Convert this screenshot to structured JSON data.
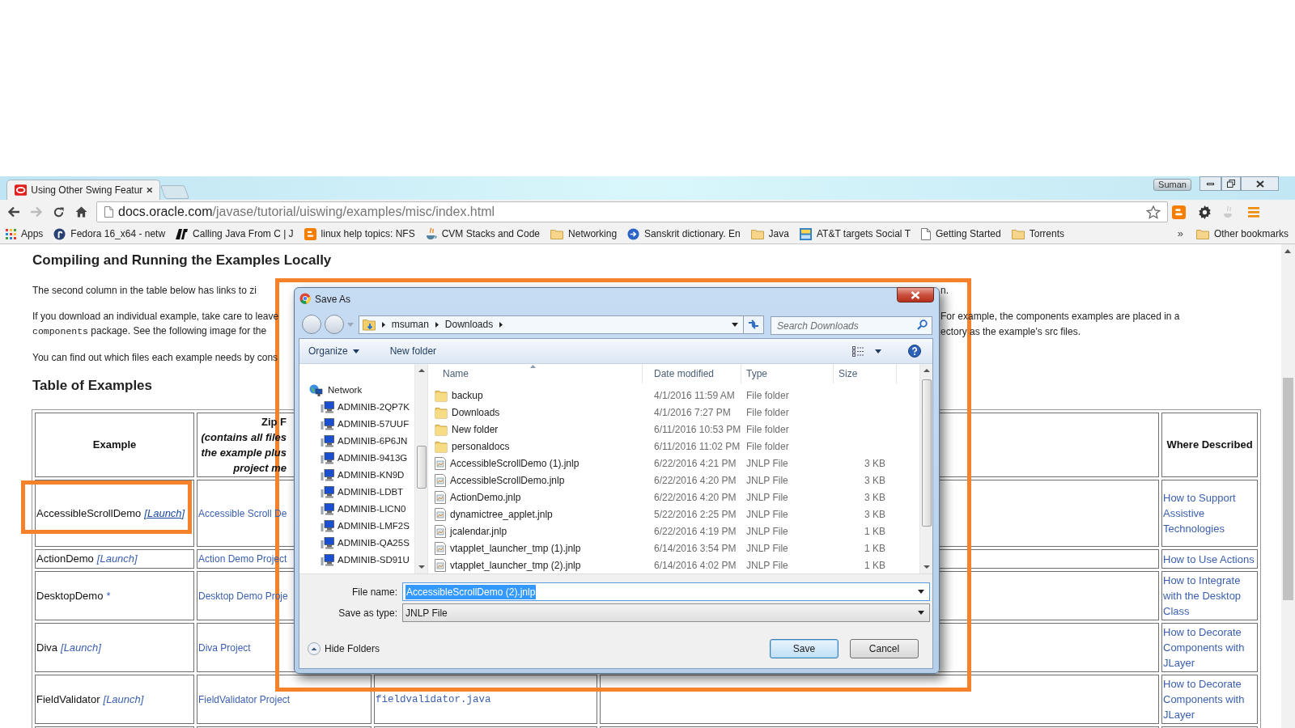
{
  "browser": {
    "tabs": [
      {
        "title": "Using Other Swing Featur",
        "selected": true
      }
    ],
    "profile": "Suman",
    "url": {
      "host": "docs.oracle.com",
      "path": "/javase/tutorial/uiswing/examples/misc/index.html"
    },
    "bookmarks": [
      {
        "label": "Apps",
        "kind": "apps"
      },
      {
        "label": "Fedora 16_x64 - netw",
        "kind": "fedora"
      },
      {
        "label": "Calling Java From C | J",
        "kind": "logo"
      },
      {
        "label": "linux help topics: NFS",
        "kind": "blogger"
      },
      {
        "label": "CVM Stacks and Code",
        "kind": "java"
      },
      {
        "label": "Networking",
        "kind": "folder"
      },
      {
        "label": "Sanskrit dictionary. En",
        "kind": "circle"
      },
      {
        "label": "Java",
        "kind": "folder"
      },
      {
        "label": "AT&T targets Social T",
        "kind": "thumbnail"
      },
      {
        "label": "Getting Started",
        "kind": "page"
      },
      {
        "label": "Torrents",
        "kind": "folder"
      }
    ],
    "overflow": "»",
    "other_bookmarks": "Other bookmarks"
  },
  "page": {
    "heading": "Compiling and Running the Examples Locally",
    "paragraphs": [
      {
        "lines": [
          {
            "left": [
              {
                "kind": "text",
                "text": "The second column in the table below has links to zi"
              }
            ],
            "right": "n."
          }
        ]
      },
      {
        "lines": [
          {
            "left": [
              {
                "kind": "text",
                "text": "If you download an individual example, take care to leave"
              }
            ],
            "right": "For example, the components examples are placed in a"
          },
          {
            "left": [
              {
                "kind": "code",
                "text": "components"
              },
              {
                "kind": "text",
                "text": " package. See the following image for the"
              }
            ],
            "right": "ectory as the example's src files."
          }
        ]
      },
      {
        "lines": [
          {
            "left": [
              {
                "kind": "text",
                "text": "You can find out which files each example needs by cons"
              }
            ]
          }
        ]
      }
    ],
    "table_heading": "Table of Examples",
    "table": {
      "header": {
        "example": "Example",
        "zip_file": [
          {
            "text": "Zip F",
            "italic": false
          },
          {
            "text": "(contains all files",
            "italic": true
          },
          {
            "text": "the example plus",
            "italic": true
          },
          {
            "text": "project me",
            "italic": true
          }
        ],
        "where_described": "Where Described"
      },
      "rows": [
        {
          "example": "AccessibleScrollDemo",
          "launch": "[Launch]",
          "hovered": true,
          "zip": "Accessible Scroll De",
          "where": "How to Support Assistive Technologies"
        },
        {
          "example": "ActionDemo",
          "launch": "[Launch]",
          "hovered": false,
          "zip": "Action Demo Project",
          "where": "How to Use Actions"
        },
        {
          "example": "DesktopDemo",
          "note": "*",
          "zip": "Desktop Demo Proje",
          "where": "How to Integrate with the Desktop Class"
        },
        {
          "example": "Diva",
          "launch": "[Launch]",
          "hovered": false,
          "zip": "Diva Project",
          "where": "How to Decorate Components with JLayer"
        },
        {
          "example": "FieldValidator",
          "launch": "[Launch]",
          "hovered": false,
          "zip": "FieldValidator Project",
          "source": "fieldvalidator.java",
          "where": "How to Decorate Components with JLayer"
        }
      ]
    }
  },
  "dialog": {
    "title": "Save As",
    "breadcrumb": [
      "msuman",
      "Downloads"
    ],
    "search_placeholder": "Search Downloads",
    "toolbar": {
      "organize": "Organize",
      "new_folder": "New folder"
    },
    "nav_tree": [
      {
        "label": "Network",
        "children": [
          {
            "label": "ADMINIB-2QP7K"
          },
          {
            "label": "ADMINIB-57UUF"
          },
          {
            "label": "ADMINIB-6P6JN"
          },
          {
            "label": "ADMINIB-9413G"
          },
          {
            "label": "ADMINIB-KN9D"
          },
          {
            "label": "ADMINIB-LDBT"
          },
          {
            "label": "ADMINIB-LICN0"
          },
          {
            "label": "ADMINIB-LMF2S"
          },
          {
            "label": "ADMINIB-QA25S"
          },
          {
            "label": "ADMINIB-SD91U"
          }
        ]
      }
    ],
    "columns": [
      "Name",
      "Date modified",
      "Type",
      "Size"
    ],
    "files": [
      {
        "name": "backup",
        "date": "4/1/2016 11:59 AM",
        "type": "File folder",
        "kind": "folder"
      },
      {
        "name": "Downloads",
        "date": "4/1/2016 7:27 PM",
        "type": "File folder",
        "kind": "folder"
      },
      {
        "name": "New folder",
        "date": "6/11/2016 10:53 PM",
        "type": "File folder",
        "kind": "folder"
      },
      {
        "name": "personaldocs",
        "date": "6/11/2016 11:02 PM",
        "type": "File folder",
        "kind": "folder"
      },
      {
        "name": "AccessibleScrollDemo (1).jnlp",
        "date": "6/22/2016 4:21 PM",
        "type": "JNLP File",
        "size": "3 KB",
        "kind": "file"
      },
      {
        "name": "AccessibleScrollDemo.jnlp",
        "date": "6/22/2016 4:20 PM",
        "type": "JNLP File",
        "size": "3 KB",
        "kind": "file"
      },
      {
        "name": "ActionDemo.jnlp",
        "date": "6/22/2016 4:20 PM",
        "type": "JNLP File",
        "size": "3 KB",
        "kind": "file"
      },
      {
        "name": "dynamictree_applet.jnlp",
        "date": "5/22/2016 2:25 PM",
        "type": "JNLP File",
        "size": "3 KB",
        "kind": "file"
      },
      {
        "name": "jcalendar.jnlp",
        "date": "6/22/2016 4:19 PM",
        "type": "JNLP File",
        "size": "1 KB",
        "kind": "file"
      },
      {
        "name": "vtapplet_launcher_tmp (1).jnlp",
        "date": "6/14/2016 3:54 PM",
        "type": "JNLP File",
        "size": "1 KB",
        "kind": "file"
      },
      {
        "name": "vtapplet_launcher_tmp (2).jnlp",
        "date": "6/14/2016 4:02 PM",
        "type": "JNLP File",
        "size": "1 KB",
        "kind": "file"
      }
    ],
    "file_name_label": "File name:",
    "file_name": "AccessibleScrollDemo (2).jnlp",
    "file_name_selected": true,
    "save_type_label": "Save as type:",
    "save_type": "JNLP File",
    "hide_folders": "Hide Folders",
    "buttons": [
      {
        "label": "Save",
        "default": true
      },
      {
        "label": "Cancel",
        "default": false
      }
    ]
  }
}
